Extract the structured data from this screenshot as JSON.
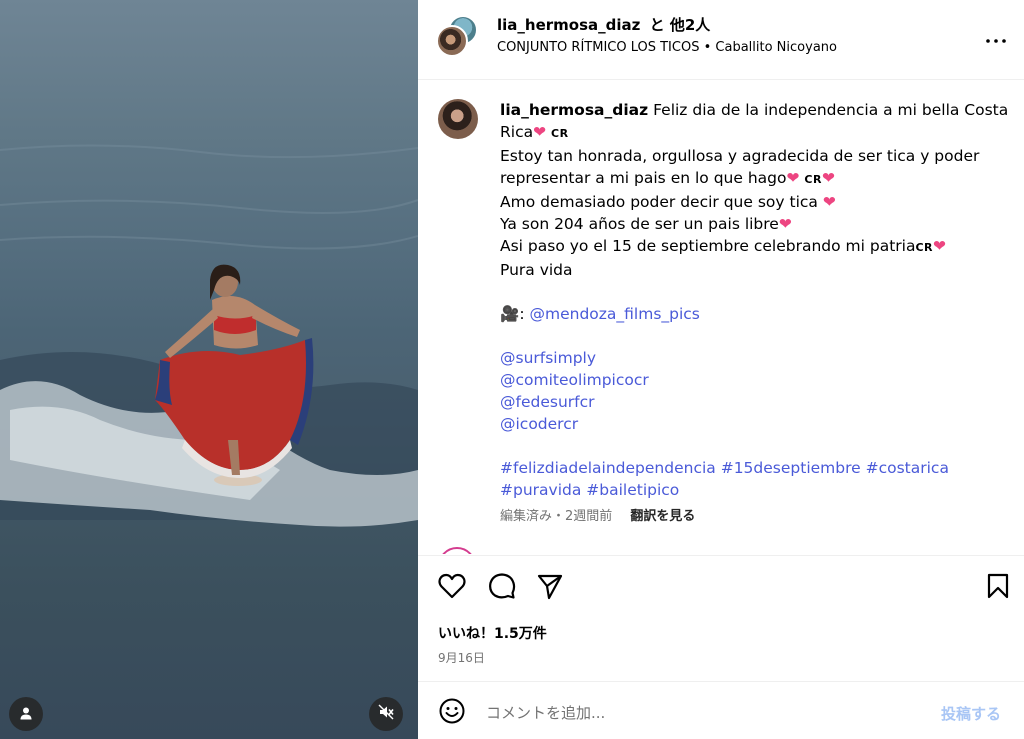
{
  "header": {
    "username": "lia_hermosa_diaz",
    "collab_suffix": "と 他2人",
    "audio_artist": "CONJUNTO RÍTMICO LOS TICOS",
    "separator": "•",
    "audio_title": "Caballito Nicoyano",
    "more_icon": "more-horizontal-icon"
  },
  "caption": {
    "username": "lia_hermosa_diaz",
    "line1": "Feliz dia de la independencia a mi bella Costa",
    "line2": "Rica",
    "line3": "Estoy tan honrada, orgullosa y agradecida de ser tica y poder",
    "line4": "representar a mi pais en lo que hago",
    "line5": "Amo demasiado poder decir que soy tica",
    "line6": "Ya son 204 años de ser un pais libre",
    "line7": "Asi paso yo el 15 de septiembre celebrando mi patria",
    "line8": "Pura vida",
    "camera_emoji": "🎥",
    "credit_prefix": ":",
    "credit_mention": "@mendoza_films_pics",
    "mentions": [
      "@surfsimply",
      "@comiteolimpicocr",
      "@fedesurfcr",
      "@icodercr"
    ],
    "hashtags_line1": "#felizdiadelaindependencia #15deseptiembre #costarica",
    "hashtags_line2": "#puravida #bailetipico",
    "heart": "❤",
    "flag": "CR"
  },
  "meta": {
    "edited_time": "編集済み・2週間前",
    "translate": "翻訳を見る"
  },
  "actions": {
    "like_icon": "heart-icon",
    "comment_icon": "comment-icon",
    "share_icon": "send-icon",
    "save_icon": "bookmark-icon"
  },
  "likes": "いいね！1.5万件",
  "date": "9月16日",
  "comment_box": {
    "placeholder": "コメントを追加...",
    "post_label": "投稿する",
    "emoji_icon": "emoji-icon"
  },
  "media": {
    "user_tag_icon": "user-icon",
    "mute_icon": "speaker-muted-icon"
  },
  "colors": {
    "link": "#4a5ad8",
    "heart": "#ed4581",
    "post_button": "#a9c6f5",
    "muted_text": "#737373"
  }
}
